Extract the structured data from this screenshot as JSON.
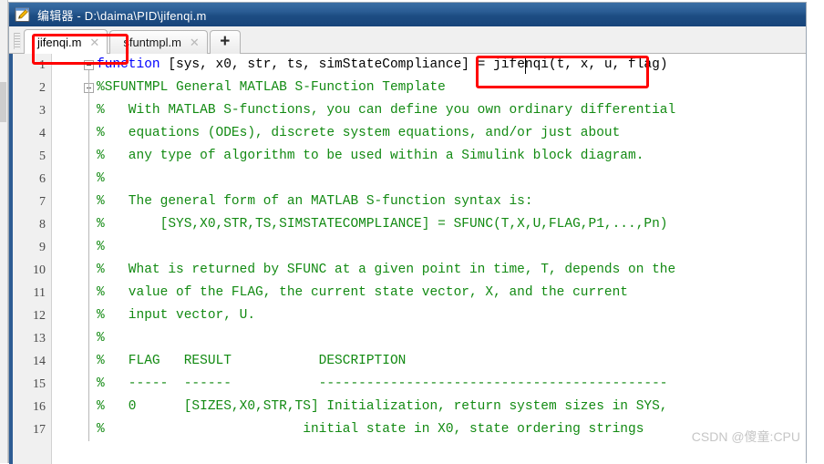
{
  "window": {
    "title": "编辑器 - D:\\daima\\PID\\jifenqi.m",
    "icon": "editor-pencil-icon"
  },
  "tabs": {
    "items": [
      {
        "label": "jifenqi.m",
        "close": "✕",
        "active": true
      },
      {
        "label": "sfuntmpl.m",
        "close": "✕",
        "active": false
      }
    ],
    "new_tab_label": "+"
  },
  "editor": {
    "lines": [
      {
        "number": "1",
        "fold": true,
        "segments": [
          {
            "text": "function ",
            "kind": "keyword"
          },
          {
            "text": "[sys, x0, str, ts, simStateCompliance] = jifenqi(t, x, u, flag)",
            "kind": "plain"
          }
        ]
      },
      {
        "number": "2",
        "fold": true,
        "segments": [
          {
            "text": "%SFUNTMPL General MATLAB S-Function Template",
            "kind": "comment"
          }
        ]
      },
      {
        "number": "3",
        "fold": false,
        "segments": [
          {
            "text": "%   With MATLAB S-functions, you can define you own ordinary differential",
            "kind": "comment"
          }
        ]
      },
      {
        "number": "4",
        "fold": false,
        "segments": [
          {
            "text": "%   equations (ODEs), discrete system equations, and/or just about",
            "kind": "comment"
          }
        ]
      },
      {
        "number": "5",
        "fold": false,
        "segments": [
          {
            "text": "%   any type of algorithm to be used within a Simulink block diagram.",
            "kind": "comment"
          }
        ]
      },
      {
        "number": "6",
        "fold": false,
        "segments": [
          {
            "text": "%",
            "kind": "comment"
          }
        ]
      },
      {
        "number": "7",
        "fold": false,
        "segments": [
          {
            "text": "%   The general form of an MATLAB S-function syntax is:",
            "kind": "comment"
          }
        ]
      },
      {
        "number": "8",
        "fold": false,
        "segments": [
          {
            "text": "%       [SYS,X0,STR,TS,SIMSTATECOMPLIANCE] = SFUNC(T,X,U,FLAG,P1,...,Pn)",
            "kind": "comment"
          }
        ]
      },
      {
        "number": "9",
        "fold": false,
        "segments": [
          {
            "text": "%",
            "kind": "comment"
          }
        ]
      },
      {
        "number": "10",
        "fold": false,
        "segments": [
          {
            "text": "%   What is returned by SFUNC at a given point in time, T, depends on the",
            "kind": "comment"
          }
        ]
      },
      {
        "number": "11",
        "fold": false,
        "segments": [
          {
            "text": "%   value of the FLAG, the current state vector, X, and the current",
            "kind": "comment"
          }
        ]
      },
      {
        "number": "12",
        "fold": false,
        "segments": [
          {
            "text": "%   input vector, U.",
            "kind": "comment"
          }
        ]
      },
      {
        "number": "13",
        "fold": false,
        "segments": [
          {
            "text": "%",
            "kind": "comment"
          }
        ]
      },
      {
        "number": "14",
        "fold": false,
        "segments": [
          {
            "text": "%   FLAG   RESULT           DESCRIPTION",
            "kind": "comment"
          }
        ]
      },
      {
        "number": "15",
        "fold": false,
        "segments": [
          {
            "text": "%   -----  ------           --------------------------------------------",
            "kind": "comment"
          }
        ]
      },
      {
        "number": "16",
        "fold": false,
        "segments": [
          {
            "text": "%   0      [SIZES,X0,STR,TS] Initialization, return system sizes in SYS,",
            "kind": "comment"
          }
        ]
      },
      {
        "number": "17",
        "fold": false,
        "segments": [
          {
            "text": "%                         initial state in X0, state ordering strings",
            "kind": "comment"
          }
        ]
      }
    ]
  },
  "annotations": {
    "boxes": [
      {
        "id": "redbox-tab",
        "name": "tab-highlight",
        "color": "#ff0000"
      },
      {
        "id": "redbox-func",
        "name": "function-name-highlight",
        "color": "#ff0000"
      }
    ]
  },
  "watermark": {
    "text": "CSDN @傻童:CPU"
  }
}
